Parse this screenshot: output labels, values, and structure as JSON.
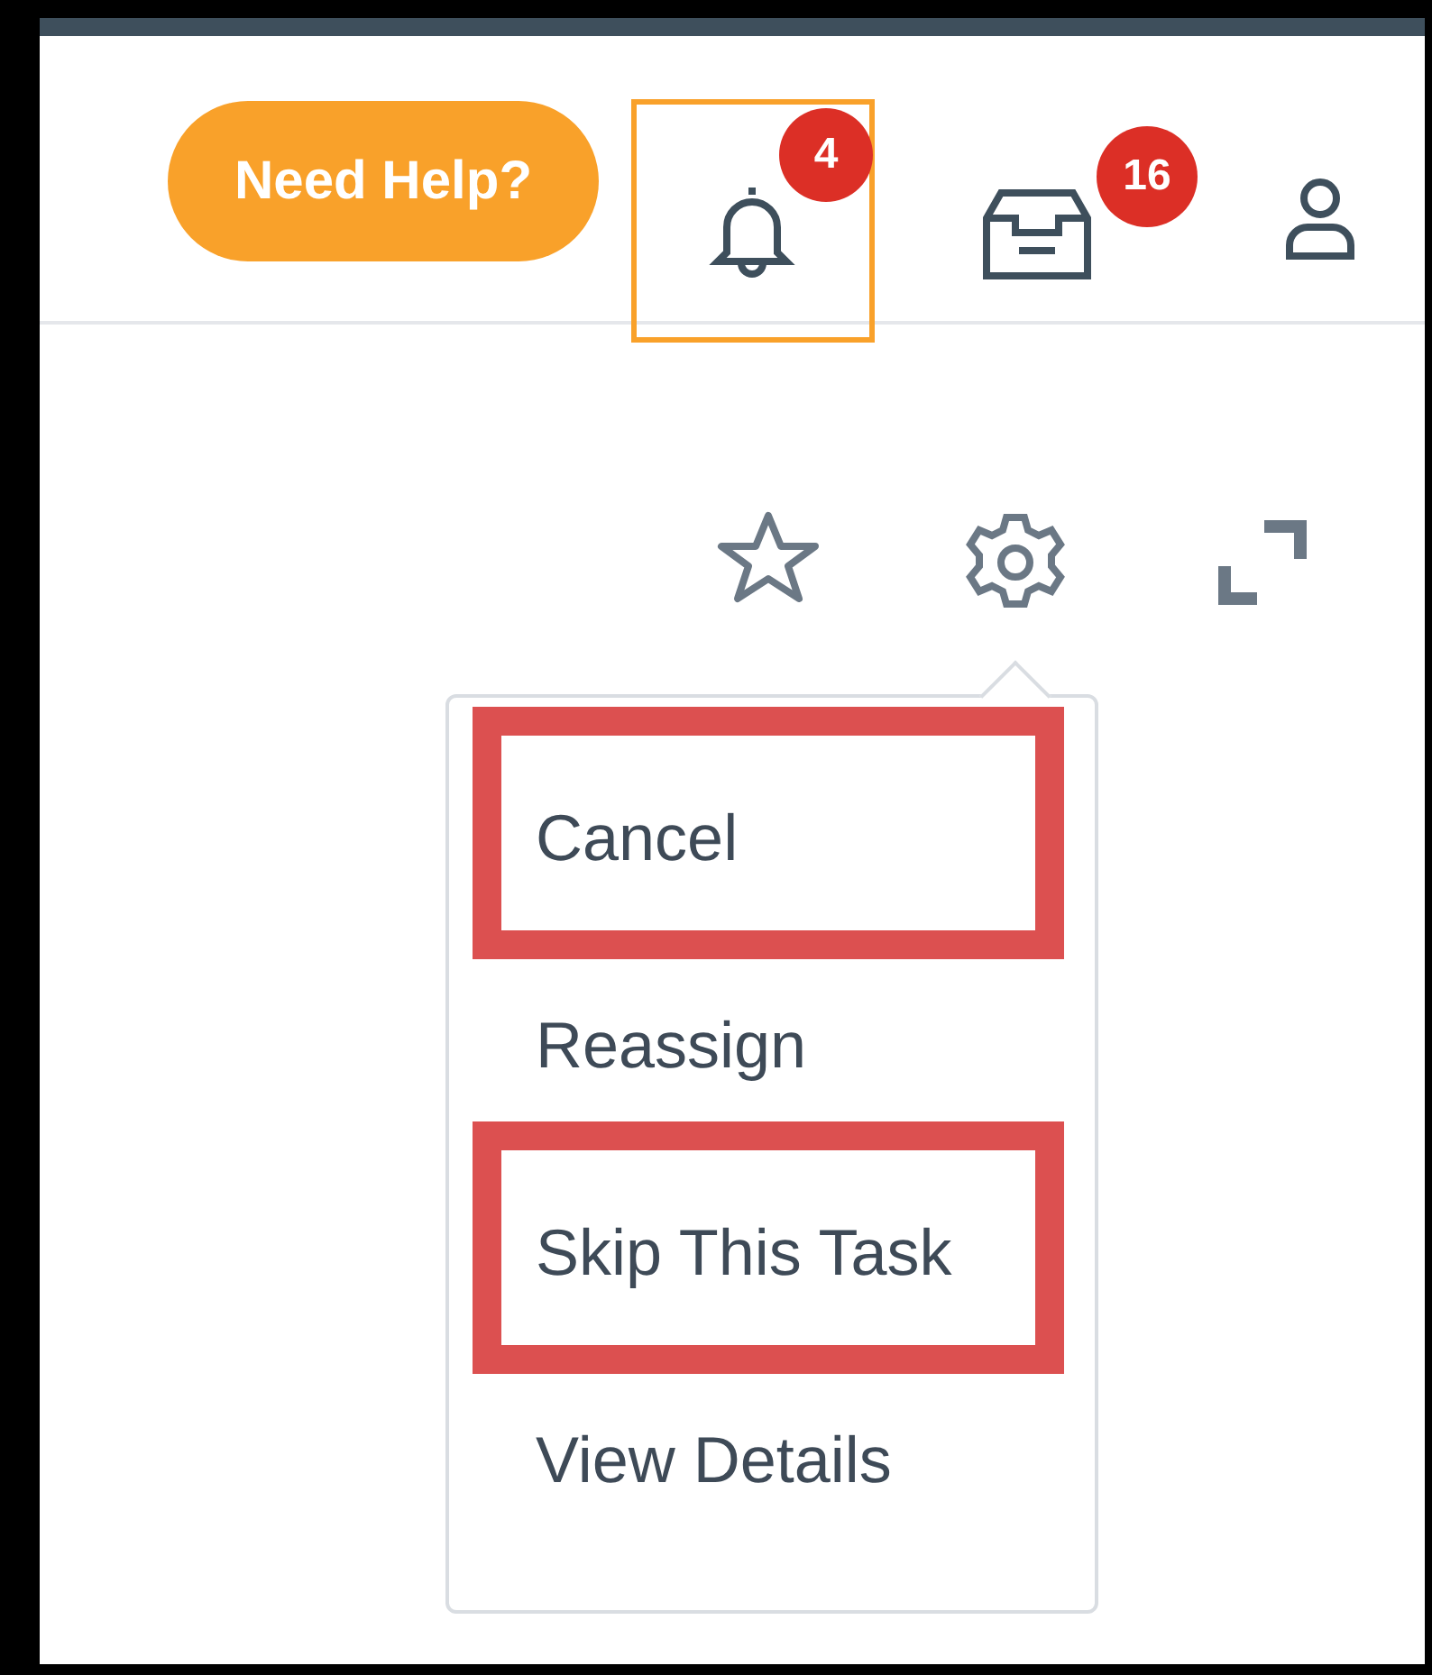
{
  "header": {
    "help_button": "Need Help?",
    "notifications": {
      "badge": "4",
      "focused": true
    },
    "inbox": {
      "badge": "16"
    }
  },
  "menu": {
    "items": [
      {
        "label": "Cancel",
        "highlighted": true
      },
      {
        "label": "Reassign",
        "highlighted": false
      },
      {
        "label": "Skip This Task",
        "highlighted": true
      },
      {
        "label": "View Details",
        "highlighted": false
      }
    ]
  }
}
